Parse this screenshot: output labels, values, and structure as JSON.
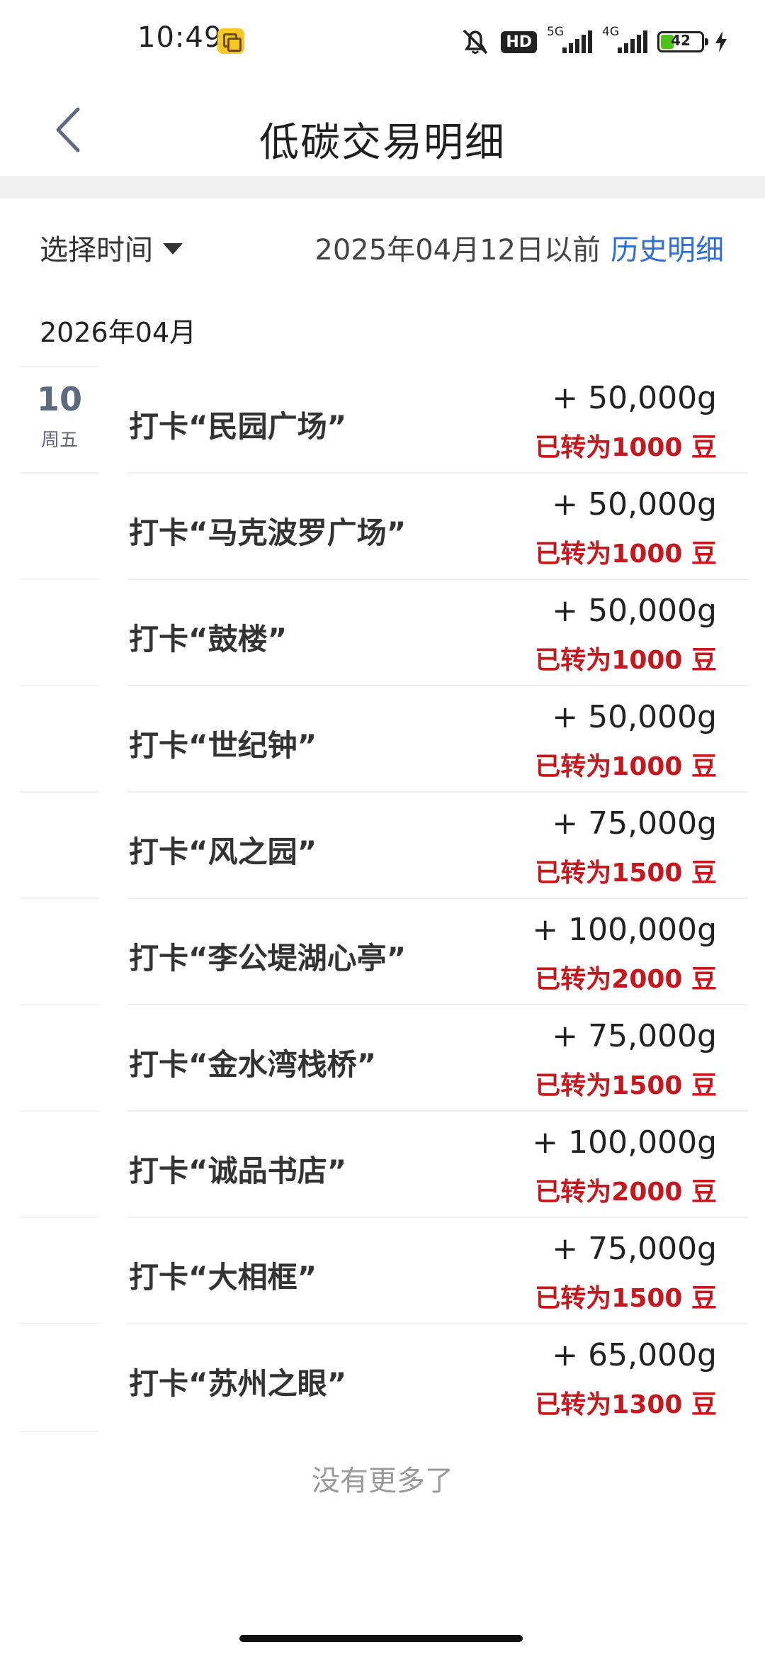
{
  "status_bar": {
    "time": "10:49",
    "hd_badge": "HD",
    "signal_1_gen": "5G",
    "signal_2_gen": "4G",
    "battery_level": "42"
  },
  "header": {
    "title": "低碳交易明细"
  },
  "filter": {
    "select_time_label": "选择时间",
    "date_before": "2025年04月12日以前",
    "history_link": "历史明细"
  },
  "month_label": "2026年04月",
  "date_group": {
    "day": "10",
    "weekday": "周五"
  },
  "transactions": [
    {
      "title": "打卡“民园广场”",
      "amount": "+ 50,000g",
      "converted": "已转为1000 豆"
    },
    {
      "title": "打卡“马克波罗广场”",
      "amount": "+ 50,000g",
      "converted": "已转为1000 豆"
    },
    {
      "title": "打卡“鼓楼”",
      "amount": "+ 50,000g",
      "converted": "已转为1000 豆"
    },
    {
      "title": "打卡“世纪钟”",
      "amount": "+ 50,000g",
      "converted": "已转为1000 豆"
    },
    {
      "title": "打卡“风之园”",
      "amount": "+ 75,000g",
      "converted": "已转为1500 豆"
    },
    {
      "title": "打卡“李公堤湖心亭”",
      "amount": "+ 100,000g",
      "converted": "已转为2000 豆"
    },
    {
      "title": "打卡“金水湾栈桥”",
      "amount": "+ 75,000g",
      "converted": "已转为1500 豆"
    },
    {
      "title": "打卡“诚品书店”",
      "amount": "+ 100,000g",
      "converted": "已转为2000 豆"
    },
    {
      "title": "打卡“大相框”",
      "amount": "+ 75,000g",
      "converted": "已转为1500 豆"
    },
    {
      "title": "打卡“苏州之眼”",
      "amount": "+ 65,000g",
      "converted": "已转为1300 豆"
    }
  ],
  "footer": {
    "no_more": "没有更多了"
  },
  "colors": {
    "accent_blue": "#2f6ed6",
    "converted_red": "#c8161d",
    "date_gray_blue": "#5c6b80"
  }
}
